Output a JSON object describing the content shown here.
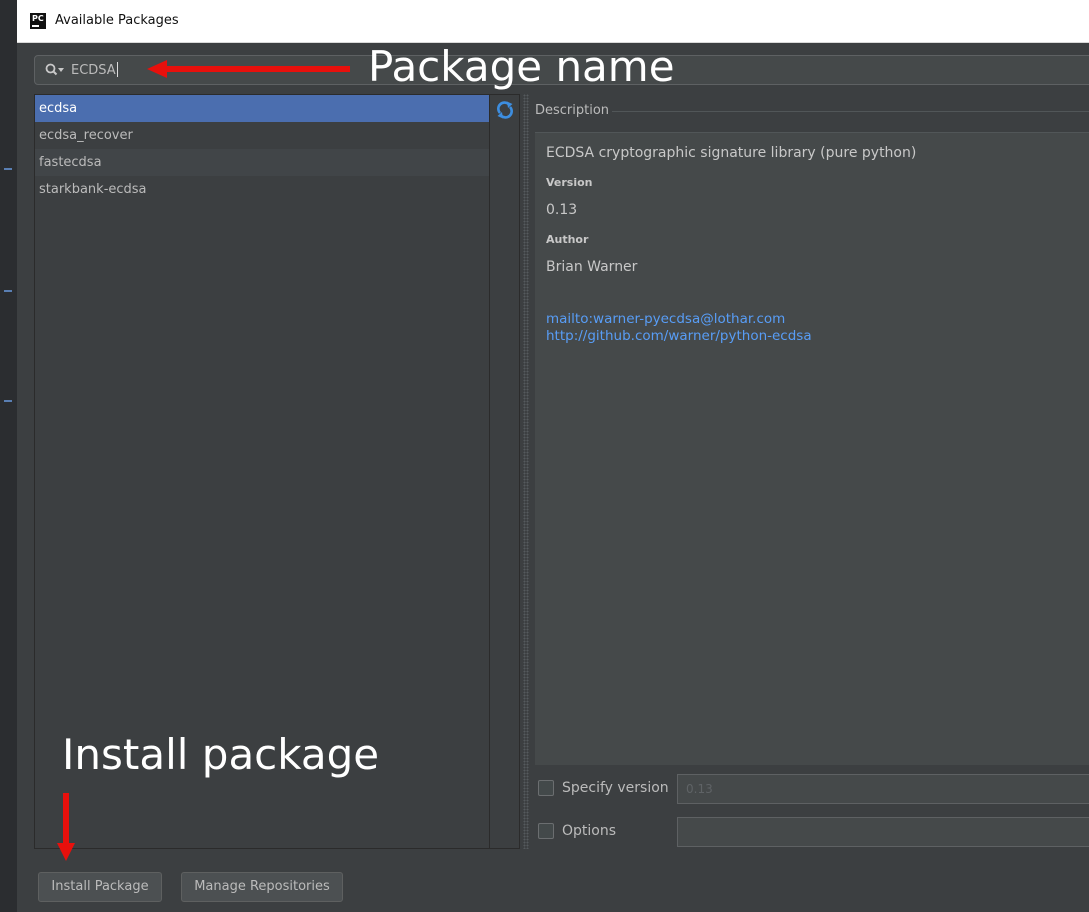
{
  "window": {
    "title": "Available Packages",
    "app_icon_text": "PC"
  },
  "search": {
    "value": "ECDSA",
    "icon": "search-icon"
  },
  "packages": [
    {
      "name": "ecdsa",
      "selected": true
    },
    {
      "name": "ecdsa_recover",
      "selected": false
    },
    {
      "name": "fastecdsa",
      "selected": false
    },
    {
      "name": "starkbank-ecdsa",
      "selected": false
    }
  ],
  "refresh_icon": "refresh-icon",
  "description": {
    "header": "Description",
    "summary": "ECDSA cryptographic signature library (pure python)",
    "version_label": "Version",
    "version_value": "0.13",
    "author_label": "Author",
    "author_value": "Brian Warner",
    "links": [
      "mailto:warner-pyecdsa@lothar.com",
      "http://github.com/warner/python-ecdsa"
    ]
  },
  "options": {
    "specify_version_label": "Specify version",
    "specify_version_value": "0.13",
    "options_label": "Options",
    "options_value": ""
  },
  "buttons": {
    "install": "Install Package",
    "manage": "Manage Repositories"
  },
  "annotations": {
    "package_name": "Package name",
    "install_package": "Install package",
    "arrow_color": "#e8100c"
  },
  "colors": {
    "selection": "#4b6eaf",
    "link": "#589df6",
    "background": "#3c3f41"
  }
}
